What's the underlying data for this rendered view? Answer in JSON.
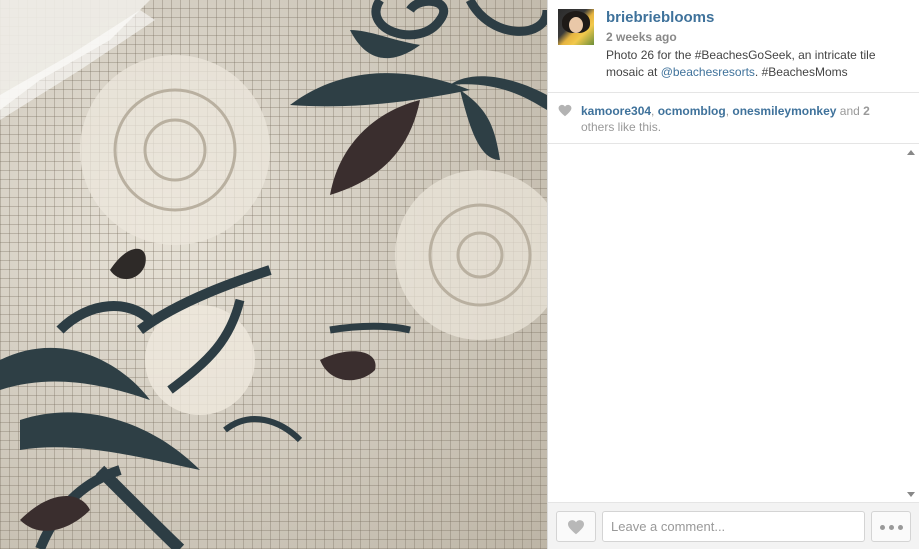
{
  "post": {
    "username": "briebrieblooms",
    "time_ago": "2 weeks ago",
    "caption_parts": {
      "before_mention": "Photo 26 for the #BeachesGoSeek, an intricate tile mosaic at ",
      "mention": "@beachesresorts",
      "after_mention": ". #BeachesMoms"
    }
  },
  "likes": {
    "likers": [
      "kamoore304",
      "ocmomblog",
      "onesmileymonkey"
    ],
    "sep1": ", ",
    "sep2": ", ",
    "and_text": " and ",
    "others_count": "2",
    "others_suffix": " others like this."
  },
  "comment_box": {
    "placeholder": "Leave a comment..."
  },
  "icons": {
    "heart": "heart-icon",
    "more": "ellipsis-icon"
  },
  "colors": {
    "link": "#3f729b",
    "muted": "#999999"
  }
}
